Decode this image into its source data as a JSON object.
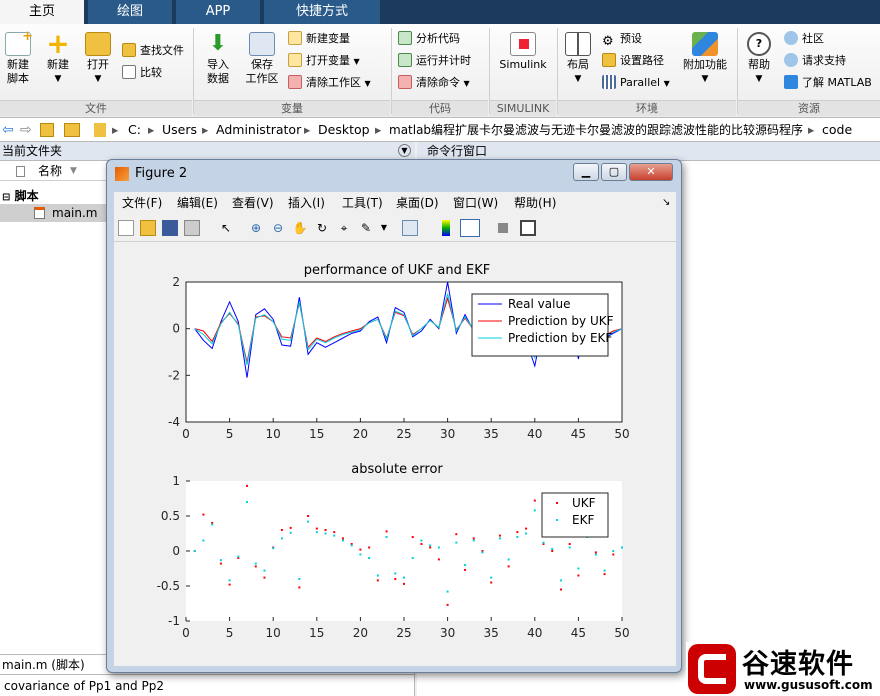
{
  "tabs": [
    "主页",
    "绘图",
    "APP",
    "快捷方式"
  ],
  "ribbon": {
    "file_group": "文件",
    "var_group": "变量",
    "code_group": "代码",
    "simulink_group": "SIMULINK",
    "env_group": "环境",
    "res_group": "资源",
    "new_script": "新建\n脚本",
    "new": "新建",
    "open": "打开",
    "find_files": "查找文件",
    "compare": "比较",
    "import": "导入\n数据",
    "save_ws": "保存\n工作区",
    "new_var": "新建变量",
    "open_var": "打开变量",
    "clear_ws": "清除工作区",
    "analyze": "分析代码",
    "run_time": "运行并计时",
    "clear_cmd": "清除命令",
    "simulink": "Simulink",
    "layout": "布局",
    "prefs": "预设",
    "set_path": "设置路径",
    "parallel": "Parallel",
    "addons": "附加功能",
    "help": "帮助",
    "community": "社区",
    "support": "请求支持",
    "learn": "了解 MATLAB"
  },
  "address": [
    "C:",
    "Users",
    "Administrator",
    "Desktop",
    "matlab编程扩展卡尔曼滤波与无迹卡尔曼滤波的跟踪滤波性能的比较源码程序",
    "code"
  ],
  "left_panel": {
    "title": "当前文件夹",
    "col_name": "名称",
    "group": "脚本",
    "file": "main.m",
    "status": "main.m (脚本)",
    "bottom_text": "covariance of Pp1 and Pp2"
  },
  "right_panel": {
    "title": "命令行窗口"
  },
  "figure": {
    "title": "Figure 2",
    "menu": [
      "文件(F)",
      "编辑(E)",
      "查看(V)",
      "插入(I)",
      "工具(T)",
      "桌面(D)",
      "窗口(W)",
      "帮助(H)"
    ]
  },
  "watermark": {
    "brand": "谷速软件",
    "url": "www.gususoft.com"
  },
  "chart_data": [
    {
      "type": "line",
      "title": "performance of UKF and EKF",
      "xlim": [
        0,
        50
      ],
      "ylim": [
        -4,
        2
      ],
      "xticks": [
        0,
        5,
        10,
        15,
        20,
        25,
        30,
        35,
        40,
        45,
        50
      ],
      "yticks": [
        -4,
        -2,
        0,
        2
      ],
      "legend_position": "top-right",
      "x": [
        1,
        2,
        3,
        4,
        5,
        6,
        7,
        8,
        9,
        10,
        11,
        12,
        13,
        14,
        15,
        16,
        17,
        18,
        19,
        20,
        21,
        22,
        23,
        24,
        25,
        26,
        27,
        28,
        29,
        30,
        31,
        32,
        33,
        34,
        35,
        36,
        37,
        38,
        39,
        40,
        41,
        42,
        43,
        44,
        45,
        46,
        47,
        48,
        49,
        50
      ],
      "series": [
        {
          "name": "Real value",
          "color": "#0000ff",
          "values": [
            0,
            -0.5,
            -0.85,
            0.3,
            1.15,
            0.3,
            -2.1,
            0.6,
            0.85,
            0.4,
            -0.7,
            -0.75,
            1.35,
            -1.1,
            -0.6,
            -0.8,
            -0.6,
            -0.4,
            -0.2,
            -0.1,
            0.3,
            0.5,
            -0.6,
            0.9,
            0.7,
            -0.35,
            -0.1,
            0.4,
            0,
            2,
            -0.2,
            0.6,
            -0.1,
            0.2,
            -0.6,
            0.55,
            -0.2,
            0.3,
            -0.5,
            -1.6,
            0.3,
            -0.2,
            0,
            0.6,
            -1.3,
            0.9,
            -0.1,
            -0.4,
            -0.2,
            0
          ]
        },
        {
          "name": "Prediction by UKF",
          "color": "#ff0000",
          "values": [
            0,
            -0.1,
            -0.55,
            0.25,
            0.65,
            0.2,
            -1.45,
            0.5,
            0.55,
            0.3,
            -0.35,
            -0.4,
            1.1,
            -0.8,
            -0.4,
            -0.55,
            -0.35,
            -0.2,
            -0.1,
            0,
            0.25,
            0.4,
            -0.4,
            0.7,
            0.55,
            -0.25,
            0,
            0.35,
            0.05,
            1.3,
            -0.05,
            0.45,
            -0.05,
            0.2,
            -0.4,
            0.4,
            -0.1,
            0.25,
            -0.35,
            -1.05,
            0.3,
            -0.1,
            0,
            0.5,
            -0.9,
            0.6,
            -0.05,
            -0.3,
            -0.1,
            0
          ]
        },
        {
          "name": "Prediction by EKF",
          "color": "#00d0e0",
          "values": [
            0,
            -0.25,
            -0.65,
            0.2,
            0.7,
            0.15,
            -1.55,
            0.45,
            0.6,
            0.3,
            -0.45,
            -0.5,
            1.15,
            -0.9,
            -0.45,
            -0.6,
            -0.4,
            -0.25,
            -0.15,
            -0.05,
            0.25,
            0.4,
            -0.45,
            0.75,
            0.6,
            -0.3,
            0,
            0.35,
            0.05,
            1.5,
            -0.1,
            0.5,
            -0.05,
            0.2,
            -0.45,
            0.45,
            -0.15,
            0.25,
            -0.4,
            -1.25,
            0.3,
            -0.15,
            0,
            0.5,
            -1,
            0.7,
            -0.05,
            -0.35,
            -0.15,
            0
          ]
        }
      ]
    },
    {
      "type": "scatter",
      "title": "absolute error",
      "xlim": [
        0,
        50
      ],
      "ylim": [
        -1,
        1
      ],
      "xticks": [
        0,
        5,
        10,
        15,
        20,
        25,
        30,
        35,
        40,
        45,
        50
      ],
      "yticks": [
        -1,
        -0.5,
        0,
        0.5,
        1
      ],
      "legend_position": "top-right",
      "x": [
        1,
        2,
        3,
        4,
        5,
        6,
        7,
        8,
        9,
        10,
        11,
        12,
        13,
        14,
        15,
        16,
        17,
        18,
        19,
        20,
        21,
        22,
        23,
        24,
        25,
        26,
        27,
        28,
        29,
        30,
        31,
        32,
        33,
        34,
        35,
        36,
        37,
        38,
        39,
        40,
        41,
        42,
        43,
        44,
        45,
        46,
        47,
        48,
        49,
        50
      ],
      "series": [
        {
          "name": "UKF",
          "color": "#ff0000",
          "values": [
            0,
            0.52,
            0.4,
            -0.18,
            -0.48,
            -0.1,
            0.93,
            -0.22,
            -0.38,
            0.05,
            0.3,
            0.33,
            -0.52,
            0.5,
            0.32,
            0.3,
            0.27,
            0.18,
            0.1,
            0.02,
            0.05,
            -0.42,
            0.28,
            -0.4,
            -0.47,
            0.2,
            0.1,
            0.05,
            -0.12,
            -0.77,
            0.24,
            -0.27,
            0.18,
            0,
            -0.45,
            0.22,
            -0.22,
            0.27,
            0.32,
            0.72,
            0.1,
            0,
            -0.55,
            0.1,
            -0.35,
            0.3,
            -0.02,
            -0.33,
            -0.05,
            0.05
          ]
        },
        {
          "name": "EKF",
          "color": "#00d0e0",
          "values": [
            0,
            0.15,
            0.38,
            -0.13,
            -0.42,
            -0.08,
            0.7,
            -0.18,
            -0.28,
            0.04,
            0.18,
            0.26,
            -0.4,
            0.42,
            0.27,
            0.25,
            0.22,
            0.15,
            0.08,
            -0.05,
            -0.1,
            -0.35,
            0.2,
            -0.32,
            -0.38,
            -0.1,
            0.15,
            0.08,
            0.05,
            -0.58,
            0.12,
            -0.2,
            0.15,
            -0.02,
            -0.38,
            0.18,
            -0.12,
            0.2,
            0.25,
            0.58,
            0.12,
            0.03,
            -0.42,
            0.05,
            -0.25,
            0.2,
            -0.05,
            -0.28,
            0,
            0.05
          ]
        }
      ]
    }
  ]
}
